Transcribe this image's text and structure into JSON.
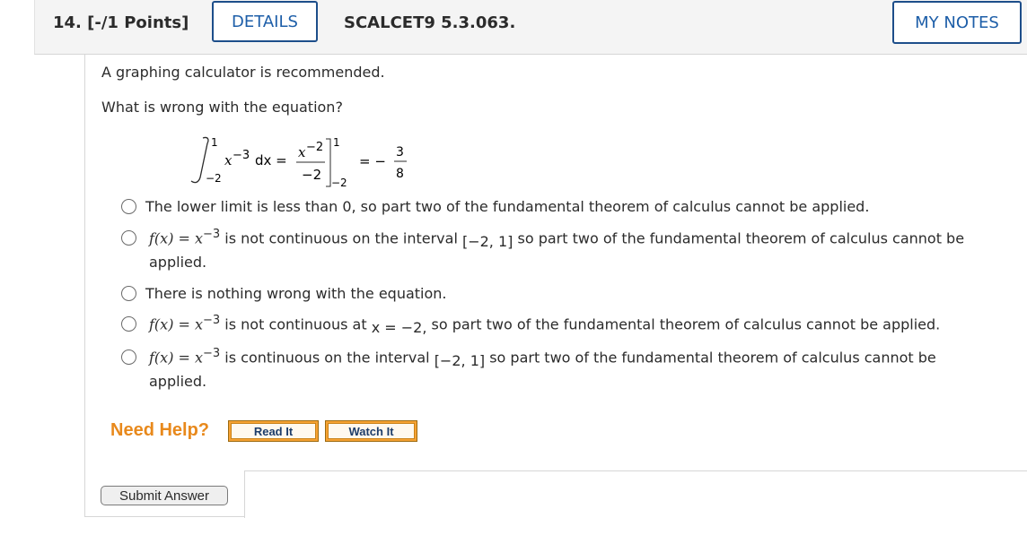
{
  "header": {
    "question_number": "14. [-/1 Points]",
    "details_label": "DETAILS",
    "code": "SCALCET9 5.3.063.",
    "notes_label": "MY NOTES"
  },
  "question": {
    "intro": "A graphing calculator is recommended.",
    "prompt": "What is wrong with the equation?",
    "equation": {
      "upper": "1",
      "lower": "−2",
      "integrand": "x",
      "integrand_exp": "−3",
      "dx": "dx =",
      "frac_num": "x",
      "frac_num_exp": "−2",
      "frac_den": "−2",
      "eval_upper": "1",
      "eval_lower": "−2",
      "equals": "= −",
      "result_num": "3",
      "result_den": "8"
    }
  },
  "options": [
    {
      "text": "The lower limit is less than 0, so part two of the fundamental theorem of calculus cannot be applied."
    },
    {
      "f": "f(x) = x",
      "exp": "−3",
      "text": " is not continuous on the interval ",
      "interval": "[−2, 1]",
      "rest": " so part two of the fundamental theorem of calculus cannot be",
      "line2": "applied."
    },
    {
      "text": "There is nothing wrong with the equation."
    },
    {
      "f": "f(x) = x",
      "exp": "−3",
      "text": " is not continuous at ",
      "point": "x = −2,",
      "rest": " so part two of the fundamental theorem of calculus cannot be applied."
    },
    {
      "f": "f(x) = x",
      "exp": "−3",
      "text": " is continuous on the interval ",
      "interval": "[−2, 1]",
      "rest": " so part two of the fundamental theorem of calculus cannot be",
      "line2": "applied."
    }
  ],
  "help": {
    "label": "Need Help?",
    "read_it": "Read It",
    "watch_it": "Watch It"
  },
  "submit_label": "Submit Answer"
}
